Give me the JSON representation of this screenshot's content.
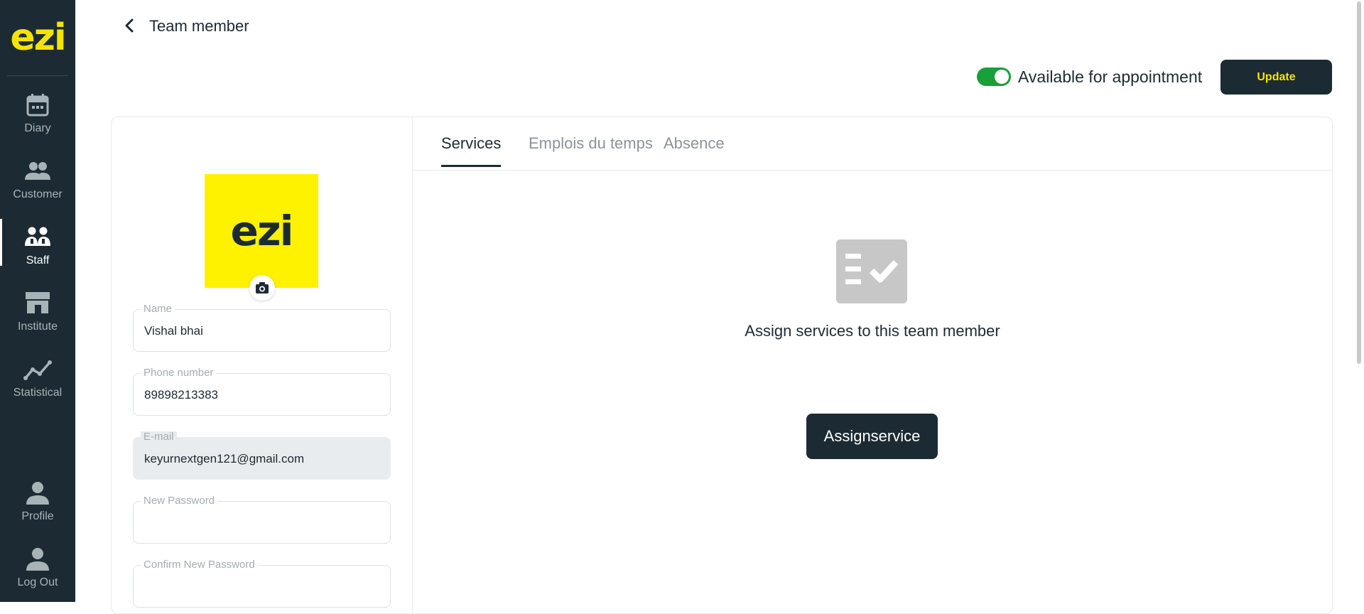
{
  "sidebar": {
    "logo": "ezi",
    "items": [
      {
        "label": "Diary",
        "icon": "calendar-icon"
      },
      {
        "label": "Customer",
        "icon": "users-icon"
      },
      {
        "label": "Staff",
        "icon": "staff-icon",
        "active": true
      },
      {
        "label": "Institute",
        "icon": "store-icon"
      },
      {
        "label": "Statistical",
        "icon": "chart-line-icon"
      }
    ],
    "bottom_items": [
      {
        "label": "Profile",
        "icon": "user-icon"
      },
      {
        "label": "Log Out",
        "icon": "user-icon"
      }
    ]
  },
  "header": {
    "title": "Team member",
    "availability_label": "Available for appointment",
    "availability_on": true,
    "update_label": "Update"
  },
  "profile": {
    "avatar_text": "ezi",
    "fields": {
      "name": {
        "label": "Name",
        "value": "Vishal bhai"
      },
      "phone": {
        "label": "Phone number",
        "value": "89898213383"
      },
      "email": {
        "label": "E-mail",
        "value": "keyurnextgen121@gmail.com"
      },
      "new_password": {
        "label": "New Password",
        "value": ""
      },
      "confirm_password": {
        "label": "Confirm New Password",
        "value": ""
      }
    }
  },
  "tabs": [
    {
      "label": "Services",
      "active": true
    },
    {
      "label": "Emplois du temps",
      "active": false
    },
    {
      "label": "Absence",
      "active": false
    }
  ],
  "services": {
    "empty_message": "Assign services to this team member",
    "assign_button": "Assignservice"
  },
  "colors": {
    "sidebar_bg": "#1c2b33",
    "brand_yellow": "#f5e400",
    "toggle_on": "#18a03a"
  }
}
